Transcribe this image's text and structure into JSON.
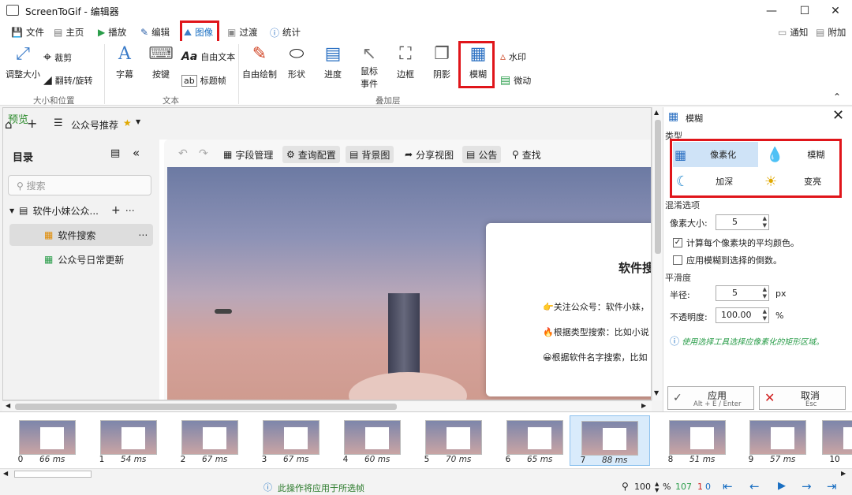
{
  "window": {
    "title": "ScreenToGif - 编辑器"
  },
  "menu": {
    "items": [
      {
        "label": "文件",
        "icon": "save-icon"
      },
      {
        "label": "主页",
        "icon": "home-icon"
      },
      {
        "label": "播放",
        "icon": "play-icon"
      },
      {
        "label": "编辑",
        "icon": "pencil-icon"
      },
      {
        "label": "图像",
        "icon": "image-icon",
        "selected": true
      },
      {
        "label": "过渡",
        "icon": "transition-icon"
      },
      {
        "label": "统计",
        "icon": "info-icon"
      }
    ],
    "notify_label": "通知",
    "extra_label": "附加"
  },
  "ribbon": {
    "size_group": {
      "label": "大小和位置",
      "resize": "调整大小",
      "crop": "裁剪",
      "flip": "翻转/旋转"
    },
    "text_group": {
      "label": "文本",
      "caption": "字幕",
      "keys": "按键",
      "freetext": "自由文本",
      "titleframe": "标题帧"
    },
    "overlay_group": {
      "label": "叠加层",
      "freedraw": "自由绘制",
      "shape": "形状",
      "progress": "进度",
      "mouse_line1": "鼠标",
      "mouse_line2": "事件",
      "border": "边框",
      "shadow": "阴影",
      "blur": "模糊",
      "watermark": "水印",
      "cinemagraph": "微动"
    }
  },
  "preview": {
    "label": "预览",
    "breadcrumb": "公众号推荐",
    "sidebar": {
      "title": "目录",
      "search_placeholder": "搜索",
      "tree_root": "软件小妹公众...",
      "item1": "软件搜索",
      "item2": "公众号日常更新"
    },
    "toolbar": {
      "fields": "字段管理",
      "query": "查询配置",
      "background": "背景图",
      "share": "分享视图",
      "notice": "公告",
      "find": "查找"
    },
    "card": {
      "title": "软件搜",
      "line1": "👉关注公众号：软件小妹，",
      "line2": "🔥根据类型搜索：比如小说",
      "line3": "😀根据软件名字搜索，比如"
    }
  },
  "panel": {
    "title": "模糊",
    "type_label": "类型",
    "types": {
      "pixelate": "像素化",
      "blur": "模糊",
      "darken": "加深",
      "lighten": "变亮"
    },
    "blend_label": "混淆选项",
    "pixel_size_label": "像素大小:",
    "pixel_size_value": "5",
    "avg_color_label": "计算每个像素块的平均颜色。",
    "apply_inverse_label": "应用模糊到选择的倒数。",
    "smooth_label": "平滑度",
    "radius_label": "半径:",
    "radius_value": "5",
    "radius_unit": "px",
    "opacity_label": "不透明度:",
    "opacity_value": "100.00",
    "opacity_unit": "%",
    "hint": "使用选择工具选择应像素化的矩形区域。",
    "apply_label": "应用",
    "apply_shortcut": "Alt + E / Enter",
    "cancel_label": "取消",
    "cancel_shortcut": "Esc"
  },
  "frames": [
    {
      "num": "0",
      "ms": "66 ms"
    },
    {
      "num": "1",
      "ms": "54 ms"
    },
    {
      "num": "2",
      "ms": "67 ms"
    },
    {
      "num": "3",
      "ms": "67 ms"
    },
    {
      "num": "4",
      "ms": "60 ms"
    },
    {
      "num": "5",
      "ms": "70 ms"
    },
    {
      "num": "6",
      "ms": "65 ms"
    },
    {
      "num": "7",
      "ms": "88 ms"
    },
    {
      "num": "8",
      "ms": "51 ms"
    },
    {
      "num": "9",
      "ms": "57 ms"
    },
    {
      "num": "10",
      "ms": ""
    }
  ],
  "status": {
    "message": "此操作将应用于所选帧",
    "zoom": "100",
    "zoom_unit": "%",
    "total_frames": "107",
    "selected_frames": "1",
    "current_frame": "0"
  },
  "colors": {
    "highlight_red": "#e0151a",
    "accent_blue": "#1a6fc2",
    "selected_frame": "#d9ebfb"
  }
}
